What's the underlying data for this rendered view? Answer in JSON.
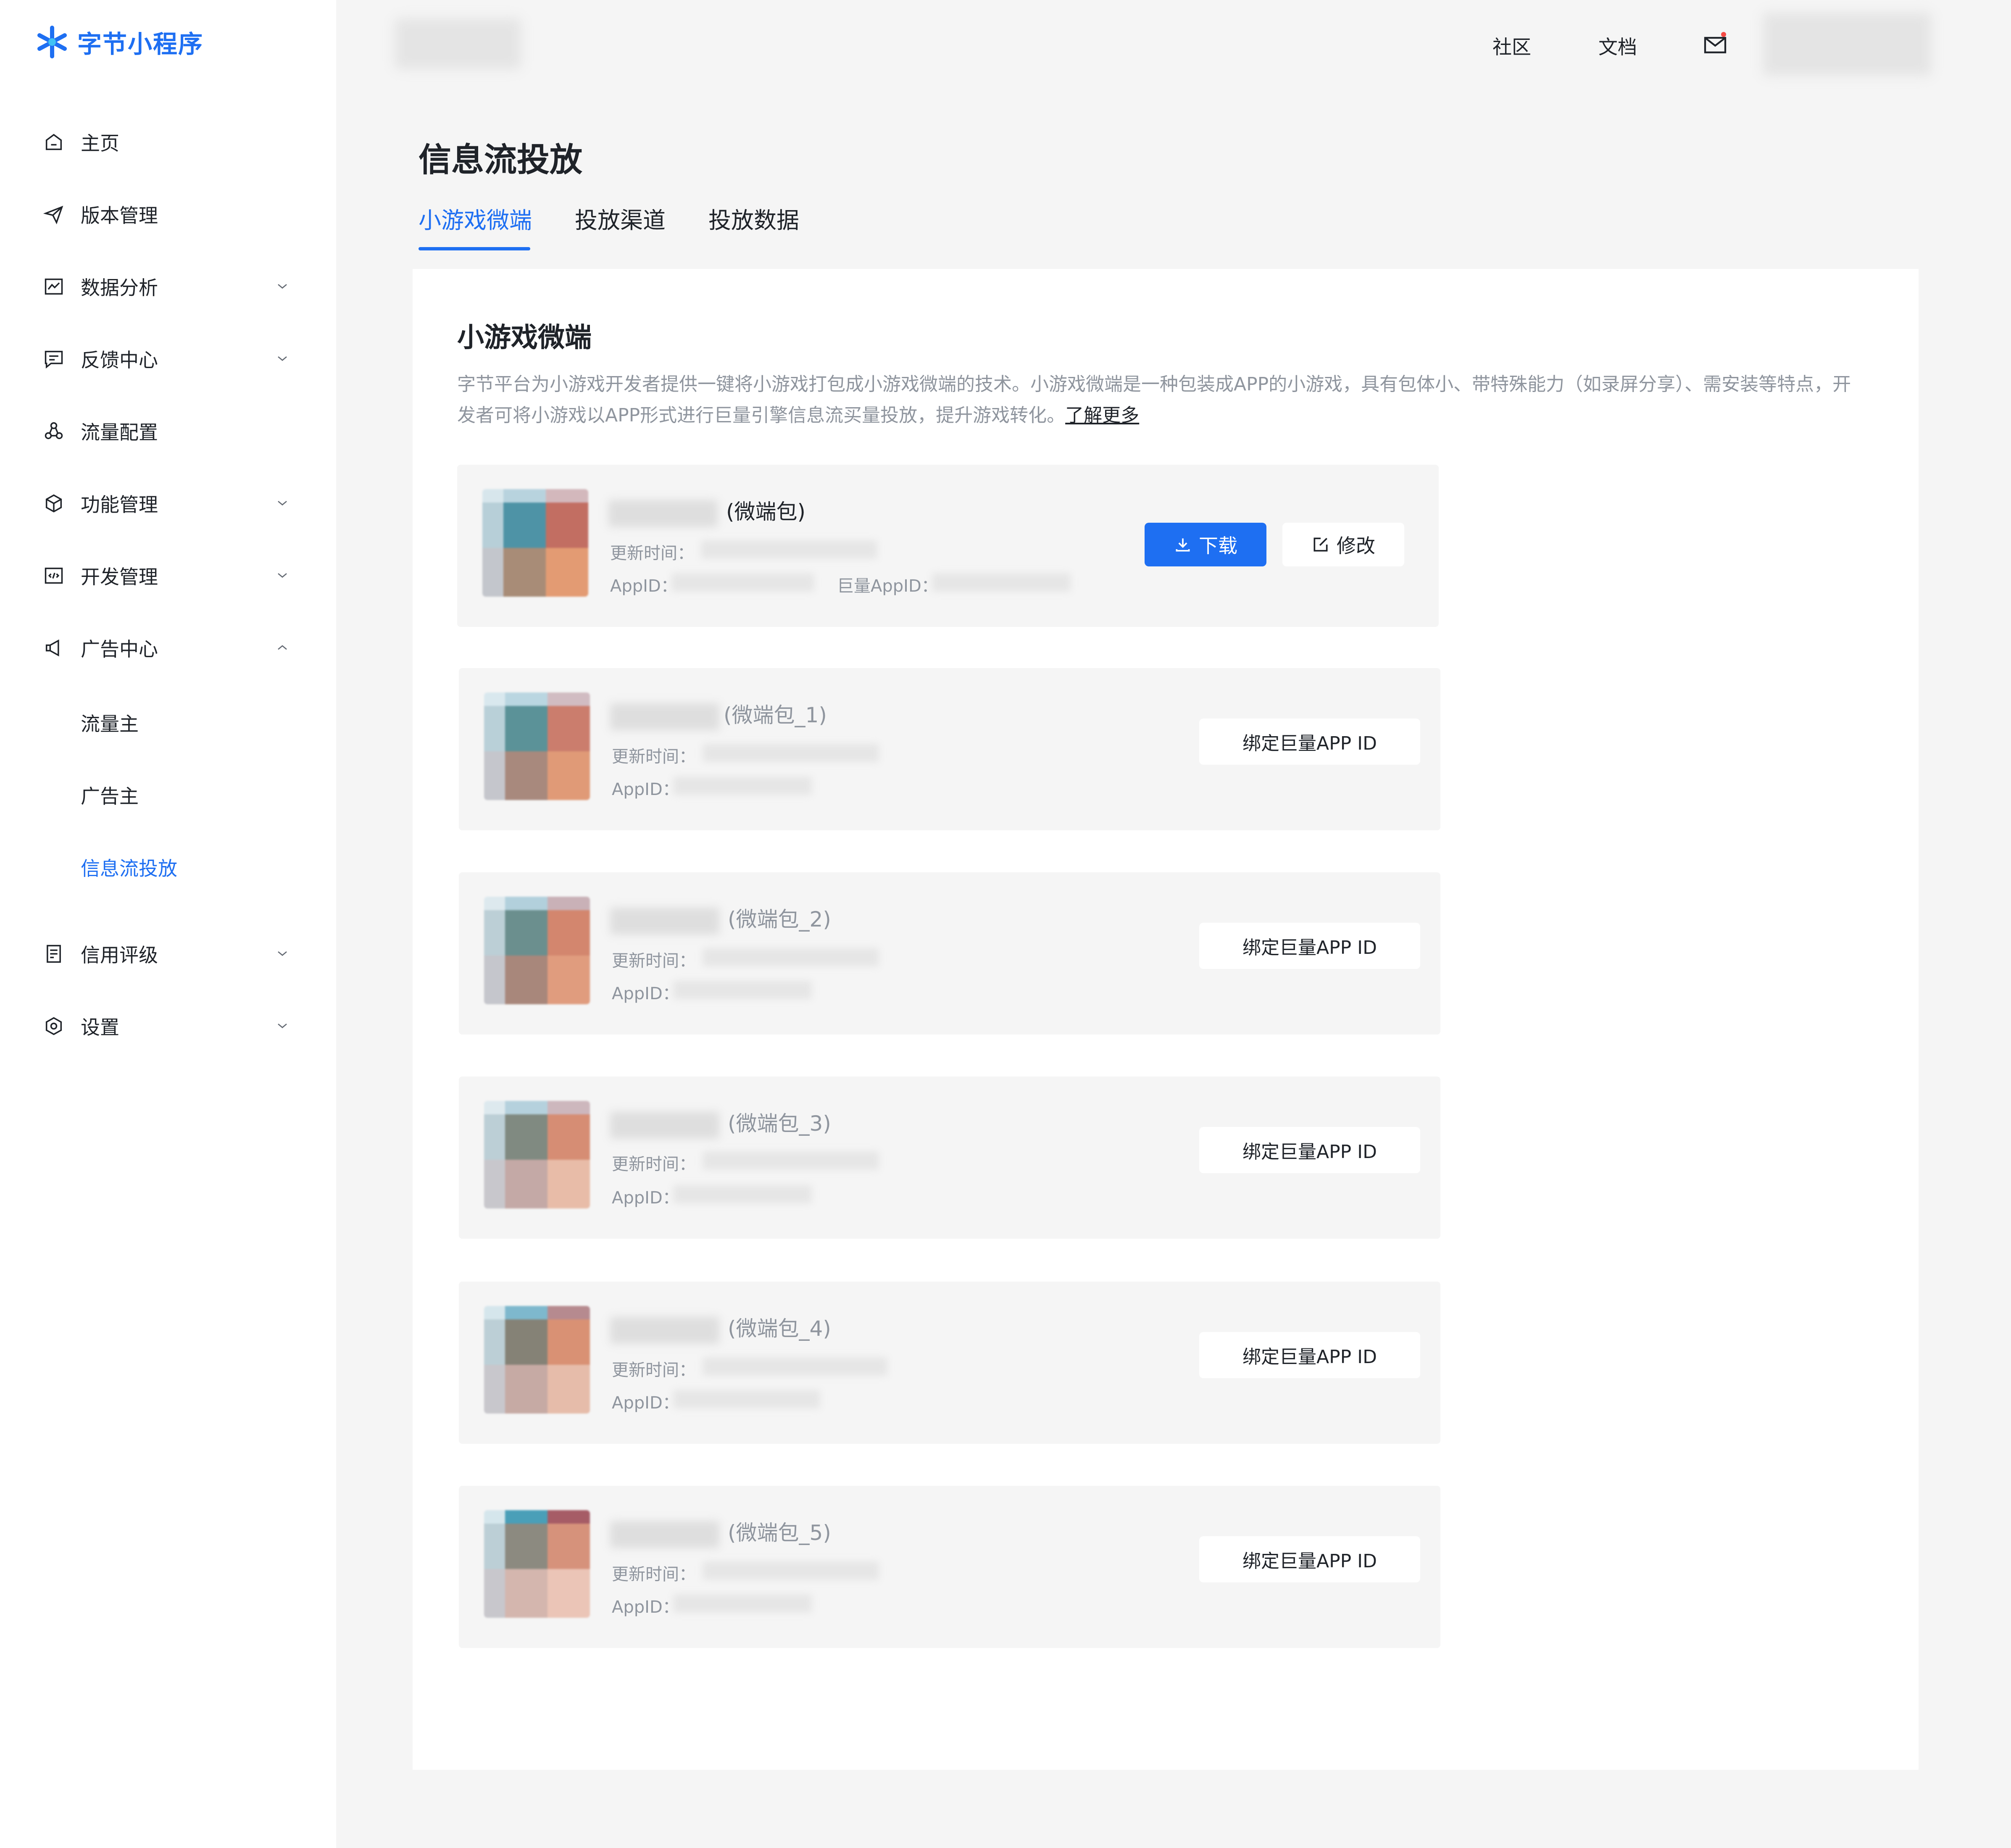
{
  "app": {
    "logo_text": "字节小程序"
  },
  "topbar": {
    "community": "社区",
    "docs": "文档"
  },
  "sidebar": {
    "items": [
      {
        "label": "主页",
        "icon": "home-icon"
      },
      {
        "label": "版本管理",
        "icon": "send-icon"
      },
      {
        "label": "数据分析",
        "icon": "chart-icon"
      },
      {
        "label": "反馈中心",
        "icon": "message-icon"
      },
      {
        "label": "流量配置",
        "icon": "share-icon"
      },
      {
        "label": "功能管理",
        "icon": "cube-icon"
      },
      {
        "label": "开发管理",
        "icon": "code-icon"
      },
      {
        "label": "广告中心",
        "icon": "megaphone-icon"
      },
      {
        "label": "信用评级",
        "icon": "list-icon"
      },
      {
        "label": "设置",
        "icon": "settings-icon"
      }
    ],
    "ad_sub": [
      {
        "label": "流量主"
      },
      {
        "label": "广告主"
      },
      {
        "label": "信息流投放"
      }
    ]
  },
  "page": {
    "title": "信息流投放",
    "tabs": [
      {
        "label": "小游戏微端"
      },
      {
        "label": "投放渠道"
      },
      {
        "label": "投放数据"
      }
    ]
  },
  "section": {
    "title": "小游戏微端",
    "desc": "字节平台为小游戏开发者提供一键将小游戏打包成小游戏微端的技术。小游戏微端是一种包装成APP的小游戏，具有包体小、带特殊能力（如录屏分享）、需安装等特点，开发者可将小游戏以APP形式进行巨量引擎信息流买量投放，提升游戏转化。",
    "learn_more": "了解更多"
  },
  "labels": {
    "update_time": "更新时间：",
    "appid": "AppID：",
    "juliang_appid": "巨量AppID：",
    "download": "下载",
    "edit": "修改",
    "bind": "绑定巨量APP ID"
  },
  "cards": [
    {
      "name": "(微端包)"
    },
    {
      "name": "(微端包_1)"
    },
    {
      "name": "(微端包_2)"
    },
    {
      "name": "(微端包_3)"
    },
    {
      "name": "(微端包_4)"
    },
    {
      "name": "(微端包_5)"
    }
  ],
  "colors": {
    "accent": "#1e6ff2",
    "muted": "#8f959e",
    "text": "#1f2329"
  }
}
